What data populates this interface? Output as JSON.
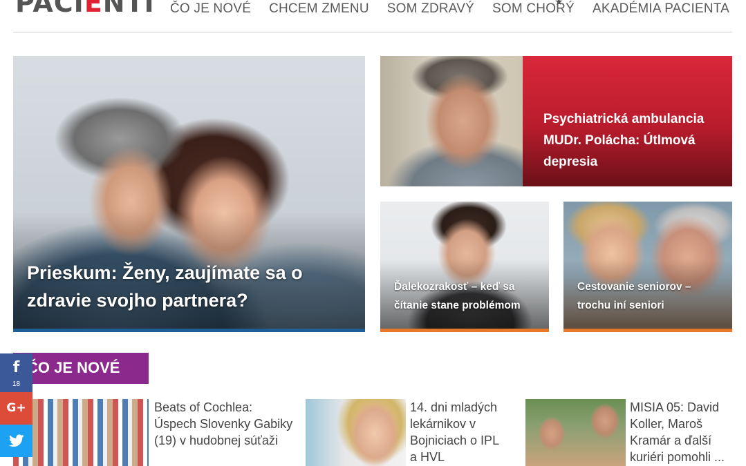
{
  "site": {
    "logo_text": "PACIENTI"
  },
  "nav": [
    {
      "label": "ČO JE NOVÉ"
    },
    {
      "label": "CHCEM ZMENU"
    },
    {
      "label": "SOM ZDRAVÝ"
    },
    {
      "label": "SOM CHORÝ"
    },
    {
      "label": "AKADÉMIA PACIENTA",
      "icon": "star-icon"
    }
  ],
  "featured": {
    "main": {
      "title": "Prieskum: Ženy, zaujímate sa o zdravie svojho partnera?"
    },
    "top_right": {
      "title": "Psychiatrická ambulancia MUDr. Polácha: Útlmová depresia"
    },
    "small": [
      {
        "title": "Ďalekozrakosť – keď sa čítanie stane problémom"
      },
      {
        "title": "Cestovanie seniorov – trochu iní seniori"
      }
    ]
  },
  "section": {
    "title": "ČO JE NOVÉ"
  },
  "articles": [
    {
      "title": "Beats of Cochlea: Úspech Slovenky Gabiky (19) v hudobnej súťaži"
    },
    {
      "title": "14. dni mladých lekárnikov v Bojniciach o IPL a HVL"
    },
    {
      "title": "MISIA 05: David Koller, Maroš Kramár a ďalší kuriéri pomohli ..."
    }
  ],
  "social": {
    "facebook": {
      "icon": "facebook-icon",
      "count": "18"
    },
    "googleplus": {
      "icon": "google-plus-icon",
      "label": "G+"
    },
    "twitter": {
      "icon": "twitter-icon"
    }
  },
  "colors": {
    "nav_text": "#5a5a5a",
    "main_tile_border": "#1f5f98",
    "small_tile_border": "#e8782a",
    "top_tile_red": "#d9283a",
    "section_badge": "#8b2a8c",
    "facebook": "#3b5998",
    "googleplus": "#dd4b39",
    "twitter": "#1da1f2"
  }
}
